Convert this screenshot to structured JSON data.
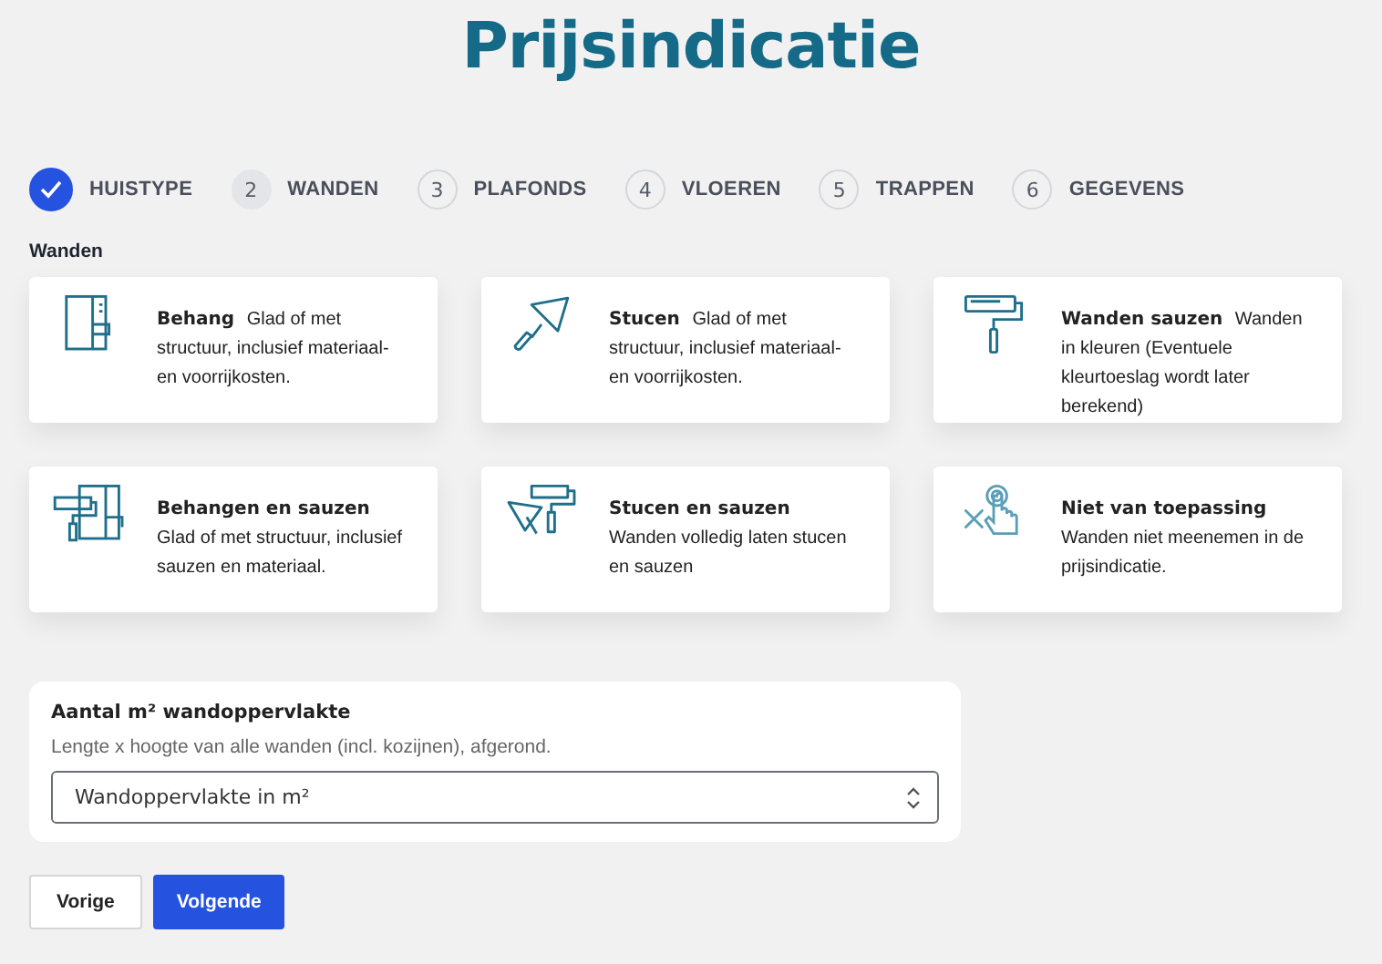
{
  "title": "Prijsindicatie",
  "steps": [
    {
      "label": "HUISTYPE",
      "done": true,
      "selected": false
    },
    {
      "number": "2",
      "label": "WANDEN",
      "done": false,
      "selected": true
    },
    {
      "number": "3",
      "label": "PLAFONDS",
      "done": false,
      "selected": false
    },
    {
      "number": "4",
      "label": "VLOEREN",
      "done": false,
      "selected": false
    },
    {
      "number": "5",
      "label": "TRAPPEN",
      "done": false,
      "selected": false
    },
    {
      "number": "6",
      "label": "GEGEVENS",
      "done": false,
      "selected": false
    }
  ],
  "section_title": "Wanden",
  "options": [
    {
      "title": "Behang",
      "description": "Glad of met structuur, inclusief materiaal- en voorrijkosten."
    },
    {
      "title": "Stucen",
      "description": "Glad of met structuur, inclusief materiaal- en voorrijkosten."
    },
    {
      "title": "Wanden sauzen",
      "description": "Wanden in kleuren (Eventuele kleurtoeslag wordt later berekend)"
    },
    {
      "title": "Behangen en sauzen",
      "description": "Glad of met structuur, inclusief sauzen en materiaal."
    },
    {
      "title": "Stucen en sauzen",
      "description": "Wanden volledig laten stucen en sauzen"
    },
    {
      "title": "Niet van toepassing",
      "description": "Wanden niet meenemen in de prijsindicatie."
    }
  ],
  "area_field": {
    "label": "Aantal m² wandoppervlakte",
    "hint": "Lengte x hoogte van alle wanden (incl. kozijnen), afgerond.",
    "placeholder": "Wandoppervlakte in m²"
  },
  "buttons": {
    "previous": "Vorige",
    "next": "Volgende"
  }
}
